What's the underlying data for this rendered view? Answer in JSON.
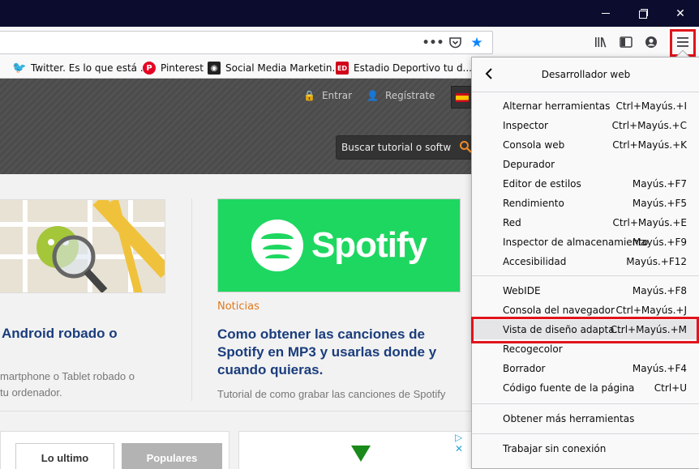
{
  "window": {
    "controls": [
      "minimize",
      "restore",
      "close"
    ]
  },
  "toolbar": {
    "url_icons": [
      "more-icon",
      "pocket-icon",
      "star-icon"
    ],
    "right_icons": [
      "library-icon",
      "sidebar-icon",
      "account-icon",
      "hamburger-menu-icon"
    ]
  },
  "bookmarks": [
    {
      "label": "Twitter. Es lo que está ...",
      "icon": "twitter-icon"
    },
    {
      "label": "Pinterest",
      "icon": "pinterest-icon"
    },
    {
      "label": "Social Media Marketin...",
      "icon": "owl-icon"
    },
    {
      "label": "Estadio Deportivo tu d...",
      "icon": "ed-icon"
    }
  ],
  "page": {
    "login": "Entrar",
    "register": "Regístrate",
    "search_placeholder": "Buscar tutorial o softw",
    "card_right": {
      "category": "Noticias",
      "title": "Como obtener las canciones de Spotify en MP3 y usarlas donde y cuando quieras.",
      "description": "Tutorial de como grabar las canciones de Spotify",
      "logo_text": "Spotify"
    },
    "card_left": {
      "title": "Android robado o",
      "description_line1": "martphone o Tablet robado o",
      "description_line2": "tu ordenador."
    },
    "tabs": [
      "Lo ultimo",
      "Populares"
    ]
  },
  "menu": {
    "title": "Desarrollador web",
    "groups": [
      [
        {
          "label": "Alternar herramientas",
          "shortcut": "Ctrl+Mayús.+I"
        },
        {
          "label": "Inspector",
          "shortcut": "Ctrl+Mayús.+C"
        },
        {
          "label": "Consola web",
          "shortcut": "Ctrl+Mayús.+K"
        },
        {
          "label": "Depurador",
          "shortcut": ""
        },
        {
          "label": "Editor de estilos",
          "shortcut": "Mayús.+F7"
        },
        {
          "label": "Rendimiento",
          "shortcut": "Mayús.+F5"
        },
        {
          "label": "Red",
          "shortcut": "Ctrl+Mayús.+E"
        },
        {
          "label": "Inspector de almacenamiento",
          "shortcut": "Mayús.+F9"
        },
        {
          "label": "Accesibilidad",
          "shortcut": "Mayús.+F12"
        }
      ],
      [
        {
          "label": "WebIDE",
          "shortcut": "Mayús.+F8"
        },
        {
          "label": "Consola del navegador",
          "shortcut": "Ctrl+Mayús.+J"
        },
        {
          "label": "Vista de diseño adapta...",
          "shortcut": "Ctrl+Mayús.+M"
        },
        {
          "label": "Recogecolor",
          "shortcut": ""
        },
        {
          "label": "Borrador",
          "shortcut": "Mayús.+F4"
        },
        {
          "label": "Código fuente de la página",
          "shortcut": "Ctrl+U"
        }
      ],
      [
        {
          "label": "Obtener más herramientas",
          "shortcut": ""
        }
      ],
      [
        {
          "label": "Trabajar sin conexión",
          "shortcut": ""
        }
      ]
    ],
    "highlighted": "Vista de diseño adapta..."
  },
  "colors": {
    "highlight_border": "#e1141b",
    "titlebar": "#0c0c2e",
    "spotify": "#1ed760",
    "link": "#1a3d7c",
    "category": "#e07a1f"
  }
}
